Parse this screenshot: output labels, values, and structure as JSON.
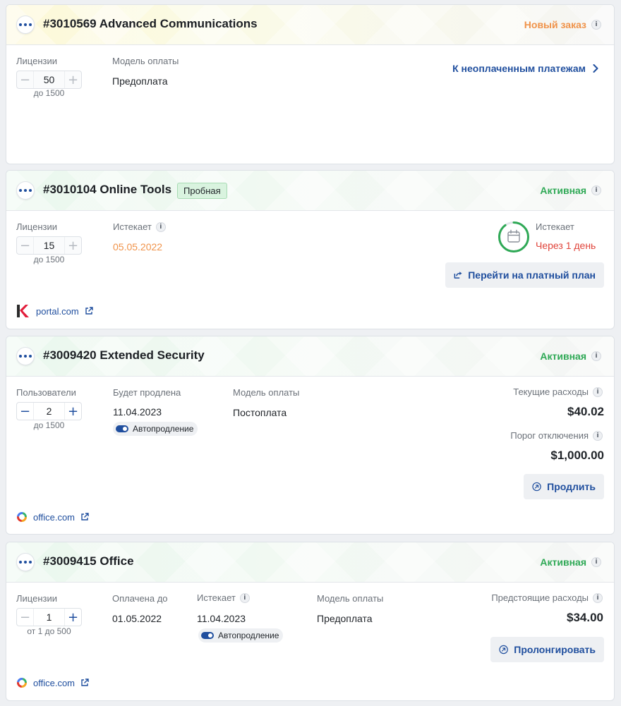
{
  "orders": [
    {
      "title": "#3010569 Advanced Communications",
      "status": "Новый заказ",
      "licenses_label": "Лицензии",
      "licenses_value": "50",
      "licenses_hint": "до 1500",
      "payment_label": "Модель оплаты",
      "payment_value": "Предоплата",
      "unpaid_link": "К неоплаченным платежам"
    },
    {
      "title": "#3010104 Online Tools",
      "badge": "Пробная",
      "status": "Активная",
      "licenses_label": "Лицензии",
      "licenses_value": "15",
      "licenses_hint": "до 1500",
      "expires_label": "Истекает",
      "expires_value": "05.05.2022",
      "countdown_label": "Истекает",
      "countdown_value": "Через 1 день",
      "upgrade_button": "Перейти на платный план",
      "domain": "portal.com"
    },
    {
      "title": "#3009420 Extended Security",
      "status": "Активная",
      "users_label": "Пользователи",
      "users_value": "2",
      "users_hint": "до 1500",
      "renew_label": "Будет продлена",
      "renew_value": "11.04.2023",
      "autorenew": "Автопродление",
      "payment_label": "Модель оплаты",
      "payment_value": "Постоплата",
      "current_label": "Текущие расходы",
      "current_value": "$40.02",
      "threshold_label": "Порог отключения",
      "threshold_value": "$1,000.00",
      "extend_button": "Продлить",
      "domain": "office.com"
    },
    {
      "title": "#3009415 Office",
      "status": "Активная",
      "licenses_label": "Лицензии",
      "licenses_value": "1",
      "licenses_hint": "от 1 до 500",
      "paid_label": "Оплачена до",
      "paid_value": "01.05.2022",
      "expires_label": "Истекает",
      "expires_value": "11.04.2023",
      "autorenew": "Автопродление",
      "payment_label": "Модель оплаты",
      "payment_value": "Предоплата",
      "upcoming_label": "Предстоящие расходы",
      "upcoming_value": "$34.00",
      "prolong_button": "Пролонгировать",
      "domain": "office.com"
    }
  ],
  "icons": {
    "info": "i",
    "minus": "−",
    "plus": "+",
    "menu": "more-dots-icon"
  },
  "colors": {
    "accent": "#1f4e9e",
    "new_status": "#f0934a",
    "active_status": "#2fa956",
    "expiring": "#e0433a"
  },
  "trial_progress_fraction": 0.9
}
